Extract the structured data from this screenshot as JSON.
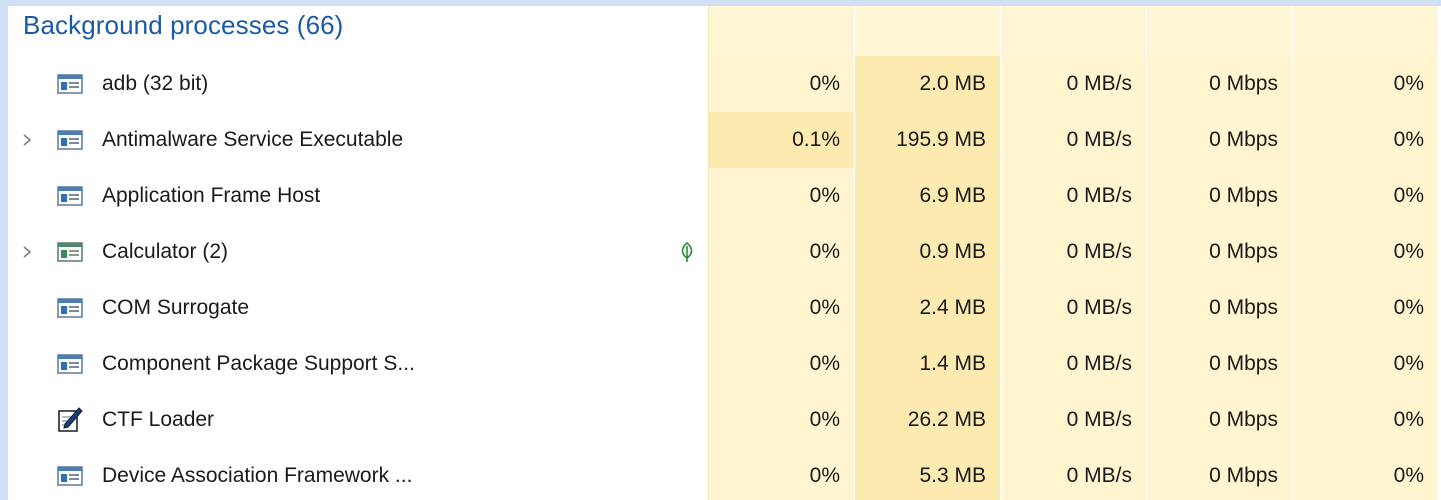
{
  "group": {
    "title": "Background processes (66)"
  },
  "rows": [
    {
      "name": "adb (32 bit)",
      "cpu": "0%",
      "memory": "2.0 MB",
      "disk": "0 MB/s",
      "network": "0 Mbps",
      "gpu": "0%",
      "icon": "app-window-icon",
      "expandable": false,
      "efficiency_leaf": false
    },
    {
      "name": "Antimalware Service Executable",
      "cpu": "0.1%",
      "memory": "195.9 MB",
      "disk": "0 MB/s",
      "network": "0 Mbps",
      "gpu": "0%",
      "icon": "app-window-icon",
      "expandable": true,
      "efficiency_leaf": false
    },
    {
      "name": "Application Frame Host",
      "cpu": "0%",
      "memory": "6.9 MB",
      "disk": "0 MB/s",
      "network": "0 Mbps",
      "gpu": "0%",
      "icon": "app-window-icon",
      "expandable": false,
      "efficiency_leaf": false
    },
    {
      "name": "Calculator (2)",
      "cpu": "0%",
      "memory": "0.9 MB",
      "disk": "0 MB/s",
      "network": "0 Mbps",
      "gpu": "0%",
      "icon": "calculator-icon",
      "expandable": true,
      "efficiency_leaf": true
    },
    {
      "name": "COM Surrogate",
      "cpu": "0%",
      "memory": "2.4 MB",
      "disk": "0 MB/s",
      "network": "0 Mbps",
      "gpu": "0%",
      "icon": "app-window-icon",
      "expandable": false,
      "efficiency_leaf": false
    },
    {
      "name": "Component Package Support S...",
      "cpu": "0%",
      "memory": "1.4 MB",
      "disk": "0 MB/s",
      "network": "0 Mbps",
      "gpu": "0%",
      "icon": "app-window-icon",
      "expandable": false,
      "efficiency_leaf": false
    },
    {
      "name": "CTF Loader",
      "cpu": "0%",
      "memory": "26.2 MB",
      "disk": "0 MB/s",
      "network": "0 Mbps",
      "gpu": "0%",
      "icon": "pen-notepad-icon",
      "expandable": false,
      "efficiency_leaf": false
    },
    {
      "name": "Device Association Framework ...",
      "cpu": "0%",
      "memory": "5.3 MB",
      "disk": "0 MB/s",
      "network": "0 Mbps",
      "gpu": "0%",
      "icon": "app-window-icon",
      "expandable": false,
      "efficiency_leaf": false
    }
  ],
  "colors": {
    "group_title": "#1c5aa6",
    "heat_light": "#fff5d0",
    "heat_mid": "#fceab0",
    "heat_strong": "#fbe4a2",
    "leaf": "#2e8b3a"
  }
}
